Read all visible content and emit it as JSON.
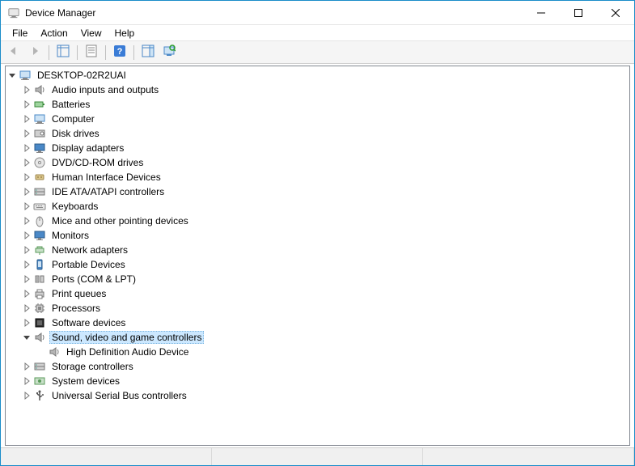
{
  "window": {
    "title": "Device Manager"
  },
  "menubar": {
    "items": [
      "File",
      "Action",
      "View",
      "Help"
    ]
  },
  "toolbar": {
    "buttons": [
      {
        "name": "back",
        "icon": "arrow-left-icon",
        "disabled": true
      },
      {
        "name": "forward",
        "icon": "arrow-right-icon",
        "disabled": true
      },
      {
        "sep": true
      },
      {
        "name": "show-hide-tree",
        "icon": "tree-view-icon"
      },
      {
        "sep": true
      },
      {
        "name": "properties",
        "icon": "properties-icon"
      },
      {
        "sep": true
      },
      {
        "name": "help",
        "icon": "help-icon"
      },
      {
        "sep": true
      },
      {
        "name": "show-hide-action",
        "icon": "action-pane-icon"
      },
      {
        "name": "scan-hardware",
        "icon": "scan-hardware-icon"
      }
    ]
  },
  "tree": {
    "root": {
      "label": "DESKTOP-02R2UAI",
      "icon": "computer-icon",
      "expanded": true,
      "children": [
        {
          "label": "Audio inputs and outputs",
          "icon": "audio-icon",
          "expandable": true
        },
        {
          "label": "Batteries",
          "icon": "battery-icon",
          "expandable": true
        },
        {
          "label": "Computer",
          "icon": "computer-icon",
          "expandable": true
        },
        {
          "label": "Disk drives",
          "icon": "disk-icon",
          "expandable": true
        },
        {
          "label": "Display adapters",
          "icon": "display-icon",
          "expandable": true
        },
        {
          "label": "DVD/CD-ROM drives",
          "icon": "dvd-icon",
          "expandable": true
        },
        {
          "label": "Human Interface Devices",
          "icon": "hid-icon",
          "expandable": true
        },
        {
          "label": "IDE ATA/ATAPI controllers",
          "icon": "ide-icon",
          "expandable": true
        },
        {
          "label": "Keyboards",
          "icon": "keyboard-icon",
          "expandable": true
        },
        {
          "label": "Mice and other pointing devices",
          "icon": "mouse-icon",
          "expandable": true
        },
        {
          "label": "Monitors",
          "icon": "monitor-icon",
          "expandable": true
        },
        {
          "label": "Network adapters",
          "icon": "network-icon",
          "expandable": true
        },
        {
          "label": "Portable Devices",
          "icon": "portable-icon",
          "expandable": true
        },
        {
          "label": "Ports (COM & LPT)",
          "icon": "ports-icon",
          "expandable": true
        },
        {
          "label": "Print queues",
          "icon": "printer-icon",
          "expandable": true
        },
        {
          "label": "Processors",
          "icon": "cpu-icon",
          "expandable": true
        },
        {
          "label": "Software devices",
          "icon": "software-icon",
          "expandable": true
        },
        {
          "label": "Sound, video and game controllers",
          "icon": "sound-icon",
          "expandable": true,
          "expanded": true,
          "selected": true,
          "children": [
            {
              "label": "High Definition Audio Device",
              "icon": "sound-icon",
              "expandable": false
            }
          ]
        },
        {
          "label": "Storage controllers",
          "icon": "storage-icon",
          "expandable": true
        },
        {
          "label": "System devices",
          "icon": "system-icon",
          "expandable": true
        },
        {
          "label": "Universal Serial Bus controllers",
          "icon": "usb-icon",
          "expandable": true
        }
      ]
    }
  }
}
